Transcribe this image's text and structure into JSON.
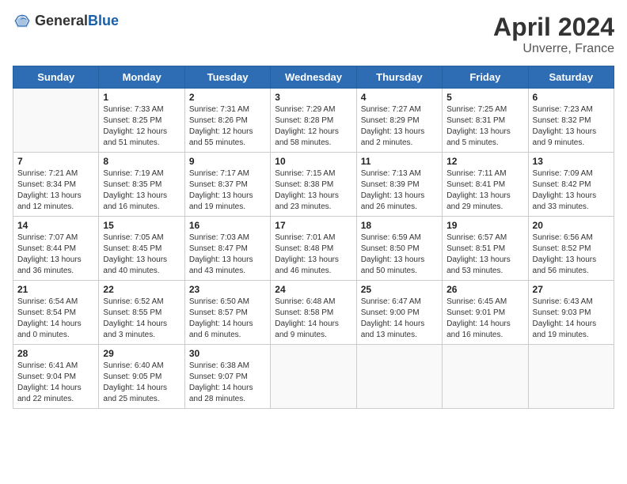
{
  "header": {
    "logo_general": "General",
    "logo_blue": "Blue",
    "month": "April 2024",
    "location": "Unverre, France"
  },
  "weekdays": [
    "Sunday",
    "Monday",
    "Tuesday",
    "Wednesday",
    "Thursday",
    "Friday",
    "Saturday"
  ],
  "weeks": [
    [
      {
        "day": "",
        "info": ""
      },
      {
        "day": "1",
        "info": "Sunrise: 7:33 AM\nSunset: 8:25 PM\nDaylight: 12 hours\nand 51 minutes."
      },
      {
        "day": "2",
        "info": "Sunrise: 7:31 AM\nSunset: 8:26 PM\nDaylight: 12 hours\nand 55 minutes."
      },
      {
        "day": "3",
        "info": "Sunrise: 7:29 AM\nSunset: 8:28 PM\nDaylight: 12 hours\nand 58 minutes."
      },
      {
        "day": "4",
        "info": "Sunrise: 7:27 AM\nSunset: 8:29 PM\nDaylight: 13 hours\nand 2 minutes."
      },
      {
        "day": "5",
        "info": "Sunrise: 7:25 AM\nSunset: 8:31 PM\nDaylight: 13 hours\nand 5 minutes."
      },
      {
        "day": "6",
        "info": "Sunrise: 7:23 AM\nSunset: 8:32 PM\nDaylight: 13 hours\nand 9 minutes."
      }
    ],
    [
      {
        "day": "7",
        "info": "Sunrise: 7:21 AM\nSunset: 8:34 PM\nDaylight: 13 hours\nand 12 minutes."
      },
      {
        "day": "8",
        "info": "Sunrise: 7:19 AM\nSunset: 8:35 PM\nDaylight: 13 hours\nand 16 minutes."
      },
      {
        "day": "9",
        "info": "Sunrise: 7:17 AM\nSunset: 8:37 PM\nDaylight: 13 hours\nand 19 minutes."
      },
      {
        "day": "10",
        "info": "Sunrise: 7:15 AM\nSunset: 8:38 PM\nDaylight: 13 hours\nand 23 minutes."
      },
      {
        "day": "11",
        "info": "Sunrise: 7:13 AM\nSunset: 8:39 PM\nDaylight: 13 hours\nand 26 minutes."
      },
      {
        "day": "12",
        "info": "Sunrise: 7:11 AM\nSunset: 8:41 PM\nDaylight: 13 hours\nand 29 minutes."
      },
      {
        "day": "13",
        "info": "Sunrise: 7:09 AM\nSunset: 8:42 PM\nDaylight: 13 hours\nand 33 minutes."
      }
    ],
    [
      {
        "day": "14",
        "info": "Sunrise: 7:07 AM\nSunset: 8:44 PM\nDaylight: 13 hours\nand 36 minutes."
      },
      {
        "day": "15",
        "info": "Sunrise: 7:05 AM\nSunset: 8:45 PM\nDaylight: 13 hours\nand 40 minutes."
      },
      {
        "day": "16",
        "info": "Sunrise: 7:03 AM\nSunset: 8:47 PM\nDaylight: 13 hours\nand 43 minutes."
      },
      {
        "day": "17",
        "info": "Sunrise: 7:01 AM\nSunset: 8:48 PM\nDaylight: 13 hours\nand 46 minutes."
      },
      {
        "day": "18",
        "info": "Sunrise: 6:59 AM\nSunset: 8:50 PM\nDaylight: 13 hours\nand 50 minutes."
      },
      {
        "day": "19",
        "info": "Sunrise: 6:57 AM\nSunset: 8:51 PM\nDaylight: 13 hours\nand 53 minutes."
      },
      {
        "day": "20",
        "info": "Sunrise: 6:56 AM\nSunset: 8:52 PM\nDaylight: 13 hours\nand 56 minutes."
      }
    ],
    [
      {
        "day": "21",
        "info": "Sunrise: 6:54 AM\nSunset: 8:54 PM\nDaylight: 14 hours\nand 0 minutes."
      },
      {
        "day": "22",
        "info": "Sunrise: 6:52 AM\nSunset: 8:55 PM\nDaylight: 14 hours\nand 3 minutes."
      },
      {
        "day": "23",
        "info": "Sunrise: 6:50 AM\nSunset: 8:57 PM\nDaylight: 14 hours\nand 6 minutes."
      },
      {
        "day": "24",
        "info": "Sunrise: 6:48 AM\nSunset: 8:58 PM\nDaylight: 14 hours\nand 9 minutes."
      },
      {
        "day": "25",
        "info": "Sunrise: 6:47 AM\nSunset: 9:00 PM\nDaylight: 14 hours\nand 13 minutes."
      },
      {
        "day": "26",
        "info": "Sunrise: 6:45 AM\nSunset: 9:01 PM\nDaylight: 14 hours\nand 16 minutes."
      },
      {
        "day": "27",
        "info": "Sunrise: 6:43 AM\nSunset: 9:03 PM\nDaylight: 14 hours\nand 19 minutes."
      }
    ],
    [
      {
        "day": "28",
        "info": "Sunrise: 6:41 AM\nSunset: 9:04 PM\nDaylight: 14 hours\nand 22 minutes."
      },
      {
        "day": "29",
        "info": "Sunrise: 6:40 AM\nSunset: 9:05 PM\nDaylight: 14 hours\nand 25 minutes."
      },
      {
        "day": "30",
        "info": "Sunrise: 6:38 AM\nSunset: 9:07 PM\nDaylight: 14 hours\nand 28 minutes."
      },
      {
        "day": "",
        "info": ""
      },
      {
        "day": "",
        "info": ""
      },
      {
        "day": "",
        "info": ""
      },
      {
        "day": "",
        "info": ""
      }
    ]
  ]
}
